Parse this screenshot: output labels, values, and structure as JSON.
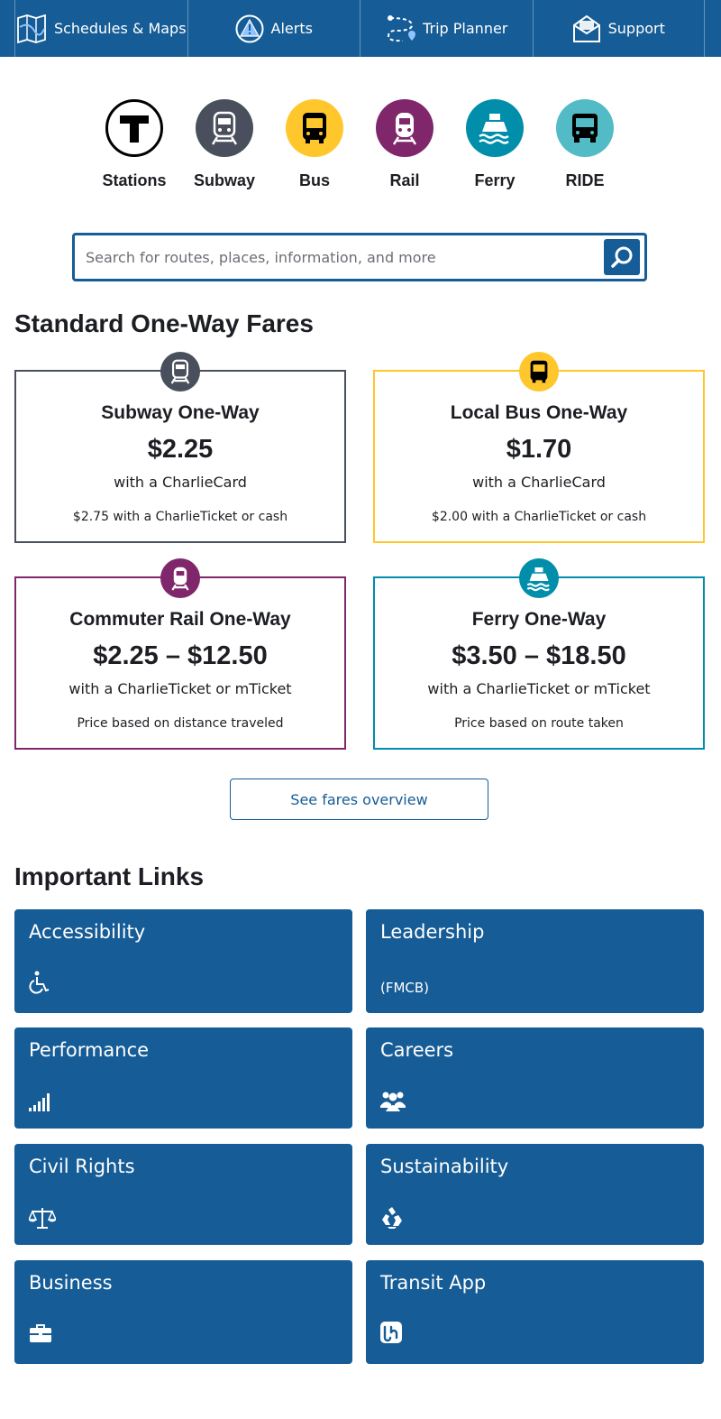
{
  "nav": {
    "items": [
      {
        "label": "Schedules & Maps",
        "icon": "map-icon"
      },
      {
        "label": "Alerts",
        "icon": "alert-icon"
      },
      {
        "label": "Trip Planner",
        "icon": "trip-planner-icon"
      },
      {
        "label": "Support",
        "icon": "support-icon"
      }
    ]
  },
  "modes": [
    {
      "label": "Stations",
      "icon": "station-t-icon",
      "color": "#ffffff"
    },
    {
      "label": "Subway",
      "icon": "subway-icon",
      "color": "#494f5c"
    },
    {
      "label": "Bus",
      "icon": "bus-icon",
      "color": "#ffc72c"
    },
    {
      "label": "Rail",
      "icon": "rail-icon",
      "color": "#80276c"
    },
    {
      "label": "Ferry",
      "icon": "ferry-icon",
      "color": "#008eaa"
    },
    {
      "label": "RIDE",
      "icon": "ride-icon",
      "color": "#52bbc5"
    }
  ],
  "search": {
    "placeholder": "Search for routes, places, information, and more",
    "button_icon": "search-icon"
  },
  "fares": {
    "heading": "Standard One-Way Fares",
    "cards": [
      {
        "title": "Subway One-Way",
        "price": "$2.25",
        "media": "with a CharlieCard",
        "note": "$2.75 with a CharlieTicket or cash",
        "color": "#494f5c",
        "icon": "subway-icon"
      },
      {
        "title": "Local Bus One-Way",
        "price": "$1.70",
        "media": "with a CharlieCard",
        "note": "$2.00 with a CharlieTicket or cash",
        "color": "#ffc72c",
        "icon": "bus-icon"
      },
      {
        "title": "Commuter Rail One-Way",
        "price": "$2.25 – $12.50",
        "media": "with a CharlieTicket or mTicket",
        "note": "Price based on distance traveled",
        "color": "#80276c",
        "icon": "rail-icon"
      },
      {
        "title": "Ferry One-Way",
        "price": "$3.50 – $18.50",
        "media": "with a CharlieTicket or mTicket",
        "note": "Price based on route taken",
        "color": "#008eaa",
        "icon": "ferry-icon"
      }
    ],
    "overview_button": "See fares overview"
  },
  "links": {
    "heading": "Important Links",
    "tiles": [
      {
        "label": "Accessibility",
        "icon": "wheelchair-icon"
      },
      {
        "label": "Leadership",
        "sub": "(FMCB)"
      },
      {
        "label": "Performance",
        "icon": "signal-bars-icon"
      },
      {
        "label": "Careers",
        "icon": "people-icon"
      },
      {
        "label": "Civil Rights",
        "icon": "scales-icon"
      },
      {
        "label": "Sustainability",
        "icon": "recycle-icon"
      },
      {
        "label": "Business",
        "icon": "briefcase-icon"
      },
      {
        "label": "Transit App",
        "icon": "transit-app-icon"
      }
    ]
  }
}
